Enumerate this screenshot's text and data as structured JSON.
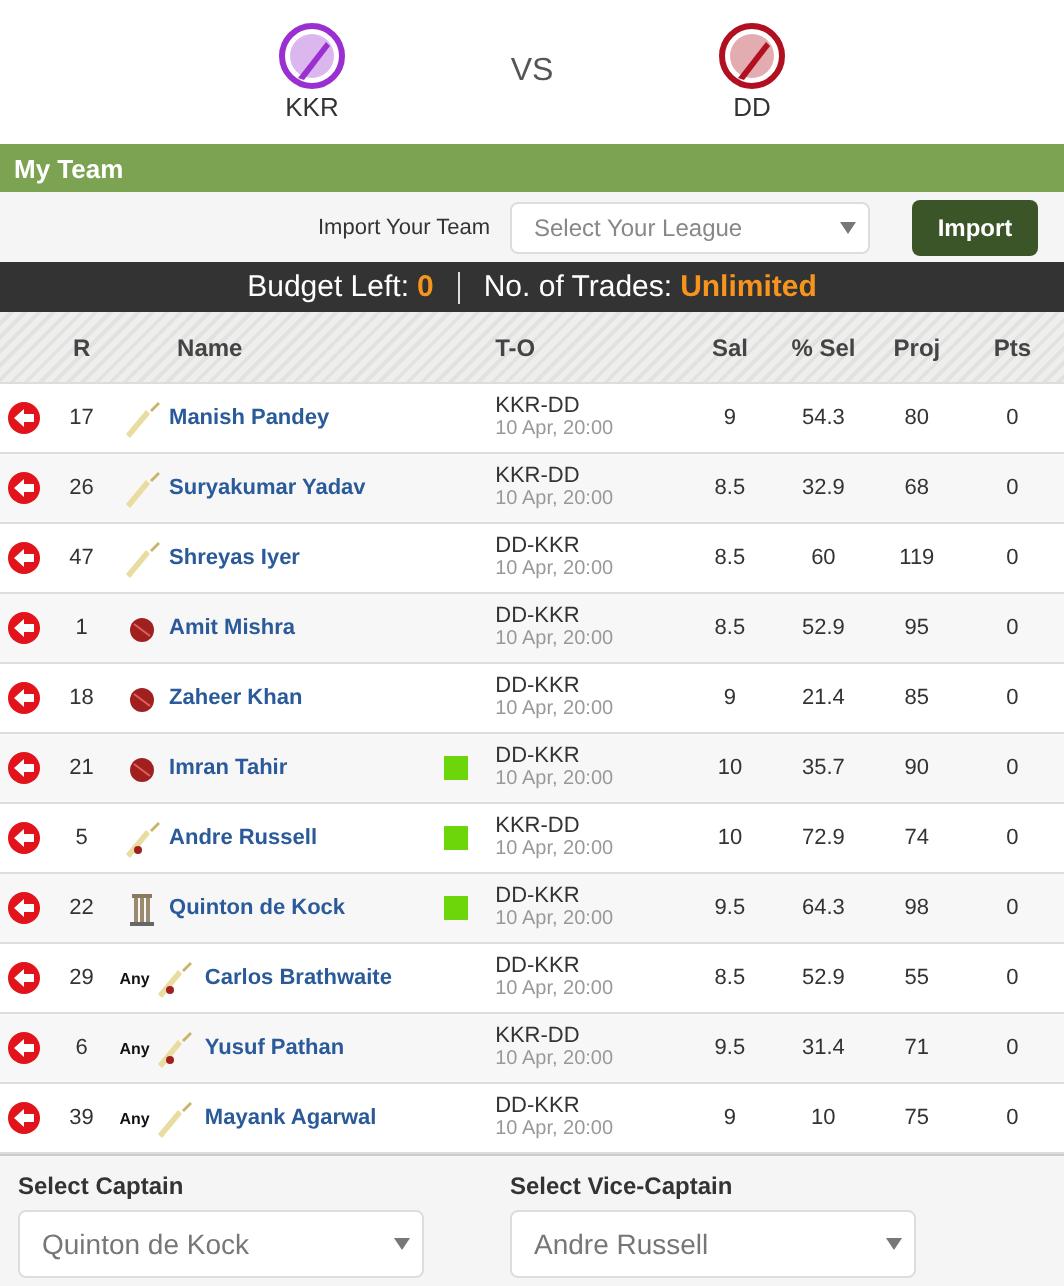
{
  "match": {
    "home": {
      "name": "KKR",
      "color": "#9b30d0"
    },
    "vs": "VS",
    "away": {
      "name": "DD",
      "color": "#b01020"
    }
  },
  "section_title": "My Team",
  "import": {
    "label": "Import Your Team",
    "placeholder": "Select Your League",
    "button": "Import"
  },
  "budget": {
    "label": "Budget Left:",
    "value": "0",
    "trades_label": "No. of Trades:",
    "trades_value": "Unlimited"
  },
  "table": {
    "columns": [
      "R",
      "Name",
      "T-O",
      "Sal",
      "% Sel",
      "Proj",
      "Pts"
    ],
    "rows": [
      {
        "rank": "17",
        "kind": "bat",
        "name": "Manish Pandey",
        "flag": false,
        "match": "KKR-DD",
        "time": "10 Apr, 20:00",
        "sal": "9",
        "sel": "54.3",
        "proj": "80",
        "pts": "0"
      },
      {
        "rank": "26",
        "kind": "bat",
        "name": "Suryakumar Yadav",
        "flag": false,
        "match": "KKR-DD",
        "time": "10 Apr, 20:00",
        "sal": "8.5",
        "sel": "32.9",
        "proj": "68",
        "pts": "0"
      },
      {
        "rank": "47",
        "kind": "bat",
        "name": "Shreyas Iyer",
        "flag": false,
        "match": "DD-KKR",
        "time": "10 Apr, 20:00",
        "sal": "8.5",
        "sel": "60",
        "proj": "119",
        "pts": "0"
      },
      {
        "rank": "1",
        "kind": "bowl",
        "name": "Amit Mishra",
        "flag": false,
        "match": "DD-KKR",
        "time": "10 Apr, 20:00",
        "sal": "8.5",
        "sel": "52.9",
        "proj": "95",
        "pts": "0"
      },
      {
        "rank": "18",
        "kind": "bowl",
        "name": "Zaheer Khan",
        "flag": false,
        "match": "DD-KKR",
        "time": "10 Apr, 20:00",
        "sal": "9",
        "sel": "21.4",
        "proj": "85",
        "pts": "0"
      },
      {
        "rank": "21",
        "kind": "bowl",
        "name": "Imran Tahir",
        "flag": true,
        "match": "DD-KKR",
        "time": "10 Apr, 20:00",
        "sal": "10",
        "sel": "35.7",
        "proj": "90",
        "pts": "0"
      },
      {
        "rank": "5",
        "kind": "ar",
        "name": "Andre Russell",
        "flag": true,
        "match": "KKR-DD",
        "time": "10 Apr, 20:00",
        "sal": "10",
        "sel": "72.9",
        "proj": "74",
        "pts": "0"
      },
      {
        "rank": "22",
        "kind": "wk",
        "name": "Quinton de Kock",
        "flag": true,
        "match": "DD-KKR",
        "time": "10 Apr, 20:00",
        "sal": "9.5",
        "sel": "64.3",
        "proj": "98",
        "pts": "0"
      },
      {
        "rank": "29",
        "kind": "ar",
        "tag": "Any",
        "name": "Carlos Brathwaite",
        "flag": false,
        "match": "DD-KKR",
        "time": "10 Apr, 20:00",
        "sal": "8.5",
        "sel": "52.9",
        "proj": "55",
        "pts": "0"
      },
      {
        "rank": "6",
        "kind": "ar",
        "tag": "Any",
        "name": "Yusuf Pathan",
        "flag": false,
        "match": "KKR-DD",
        "time": "10 Apr, 20:00",
        "sal": "9.5",
        "sel": "31.4",
        "proj": "71",
        "pts": "0"
      },
      {
        "rank": "39",
        "kind": "bat",
        "tag": "Any",
        "name": "Mayank Agarwal",
        "flag": false,
        "match": "DD-KKR",
        "time": "10 Apr, 20:00",
        "sal": "9",
        "sel": "10",
        "proj": "75",
        "pts": "0"
      }
    ]
  },
  "captain": {
    "label": "Select Captain",
    "value": "Quinton de Kock"
  },
  "vice_captain": {
    "label": "Select Vice-Captain",
    "value": "Andre Russell"
  }
}
